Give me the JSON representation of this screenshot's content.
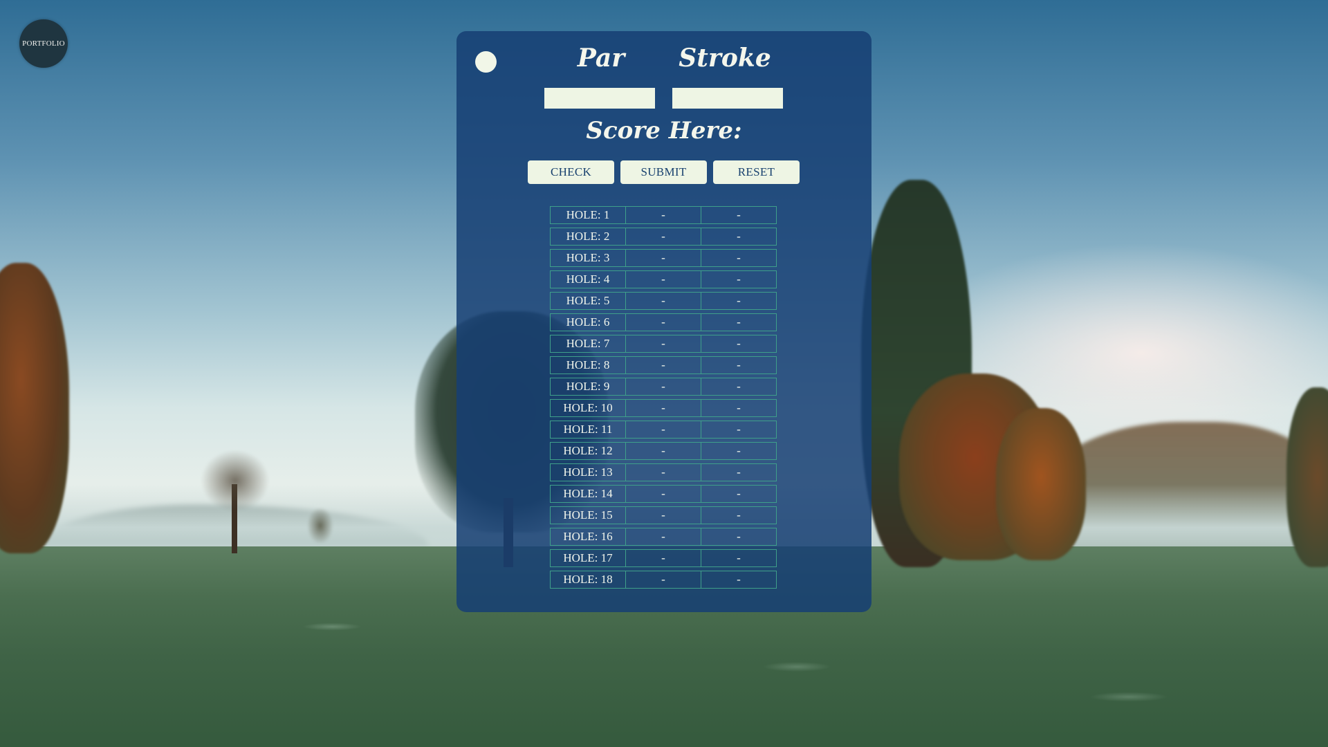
{
  "portfolio_label": "PORTFOLIO",
  "headers": {
    "par": "Par",
    "stroke": "Stroke"
  },
  "inputs": {
    "par_value": "",
    "stroke_value": ""
  },
  "score_title": "Score Here:",
  "buttons": {
    "check": "CHECK",
    "submit": "SUBMIT",
    "reset": "RESET"
  },
  "holes": [
    {
      "label": "HOLE: 1",
      "par": "-",
      "stroke": "-"
    },
    {
      "label": "HOLE: 2",
      "par": "-",
      "stroke": "-"
    },
    {
      "label": "HOLE: 3",
      "par": "-",
      "stroke": "-"
    },
    {
      "label": "HOLE: 4",
      "par": "-",
      "stroke": "-"
    },
    {
      "label": "HOLE: 5",
      "par": "-",
      "stroke": "-"
    },
    {
      "label": "HOLE: 6",
      "par": "-",
      "stroke": "-"
    },
    {
      "label": "HOLE: 7",
      "par": "-",
      "stroke": "-"
    },
    {
      "label": "HOLE: 8",
      "par": "-",
      "stroke": "-"
    },
    {
      "label": "HOLE: 9",
      "par": "-",
      "stroke": "-"
    },
    {
      "label": "HOLE: 10",
      "par": "-",
      "stroke": "-"
    },
    {
      "label": "HOLE: 11",
      "par": "-",
      "stroke": "-"
    },
    {
      "label": "HOLE: 12",
      "par": "-",
      "stroke": "-"
    },
    {
      "label": "HOLE: 13",
      "par": "-",
      "stroke": "-"
    },
    {
      "label": "HOLE: 14",
      "par": "-",
      "stroke": "-"
    },
    {
      "label": "HOLE: 15",
      "par": "-",
      "stroke": "-"
    },
    {
      "label": "HOLE: 16",
      "par": "-",
      "stroke": "-"
    },
    {
      "label": "HOLE: 17",
      "par": "-",
      "stroke": "-"
    },
    {
      "label": "HOLE: 18",
      "par": "-",
      "stroke": "-"
    }
  ],
  "colors": {
    "card": "#163f73",
    "cream": "#eef5e4",
    "table_border": "#3fa08a",
    "button_text": "#17406e"
  }
}
